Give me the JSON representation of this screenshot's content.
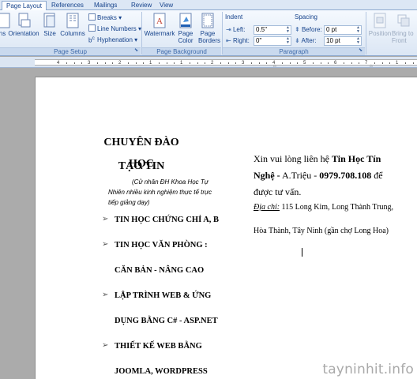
{
  "tabs": [
    {
      "label": "Page Layout",
      "active": true
    },
    {
      "label": "References",
      "active": false
    },
    {
      "label": "Mailings",
      "active": false
    },
    {
      "label": "Review",
      "active": false
    },
    {
      "label": "View",
      "active": false
    }
  ],
  "page_setup": {
    "margins_label": "ns",
    "orientation_label": "Orientation",
    "size_label": "Size",
    "columns_label": "Columns",
    "breaks_label": "Breaks",
    "line_numbers_label": "Line Numbers",
    "hyphenation_label": "Hyphenation",
    "group_label": "Page Setup"
  },
  "page_background": {
    "watermark_label": "Watermark",
    "page_color_label": "Page Color",
    "page_borders_label": "Page Borders",
    "group_label": "Page Background"
  },
  "paragraph": {
    "indent_title": "Indent",
    "left_label": "Left:",
    "left_value": "0.5\"",
    "right_label": "Right:",
    "right_value": "0\"",
    "spacing_title": "Spacing",
    "before_label": "Before:",
    "before_value": "0 pt",
    "after_label": "After:",
    "after_value": "10 pt",
    "group_label": "Paragraph"
  },
  "arrange": {
    "position_label": "Position",
    "bring_label": "Bring to Front"
  },
  "ruler": {
    "numbers": [
      "4",
      "3",
      "2",
      "1",
      "1",
      "2",
      "3",
      "4",
      "5",
      "6",
      "7",
      "1"
    ]
  },
  "document": {
    "title_line1": "CHUYÊN ĐÀO TẠO TIN",
    "title_line2": "HỌC",
    "subtitle_line1": "(Cử nhân ĐH Khoa Học Tự",
    "subtitle_line2": "Nhiên nhiều kinh nghiệm thực tế trực",
    "subtitle_line3": "tiếp giảng dạy)",
    "bullets": [
      "TIN HỌC CHỨNG CHỈ  A, B",
      "TIN HỌC VĂN PHÒNG  :",
      "CĂN BẢN - NÂNG CAO",
      "LẬP TRÌNH WEB & ỨNG",
      "DỤNG BẰNG  C# - ASP.NET",
      "THIẾT KẾ WEB BẰNG",
      "JOOMLA, WORDPRESS"
    ],
    "contact_intro": "Xin vui lòng liên hệ ",
    "contact_name": "Tin Học Tín",
    "contact_name2": "Nghệ -",
    "contact_person": "  A.Triệu - ",
    "contact_phone": "0979.708.108",
    "contact_tail": "  để",
    "contact_line3": "được tư vấn.",
    "address_label": "Địa chỉ:",
    "address_value": " 115 Long Kim, Long Thành Trung,",
    "address_line2": "Hòa Thành, Tây Ninh (gần chợ Long Hoa)"
  },
  "watermark_text": "tayninhit.info",
  "colors": {
    "ribbon_text": "#15428b",
    "ribbon_bg": "#dbe6f4",
    "workspace_bg": "#ababab",
    "page_bg": "#ffffff"
  }
}
